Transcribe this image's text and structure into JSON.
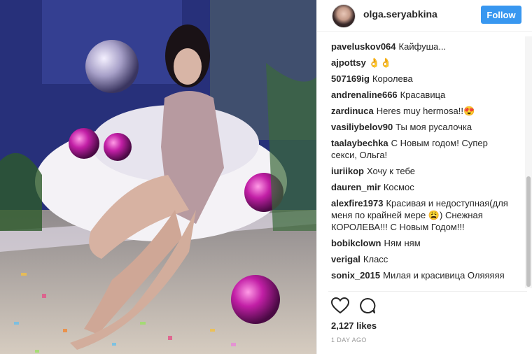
{
  "post": {
    "username": "olga.seryabkina",
    "follow_label": "Follow",
    "likes": "2,127 likes",
    "timestamp": "1 DAY AGO"
  },
  "comments": [
    {
      "user": "paveluskov064",
      "text": "Кайфуша..."
    },
    {
      "user": "ajpottsy",
      "text": "👌👌"
    },
    {
      "user": "507169ig",
      "text": "Королева"
    },
    {
      "user": "andrenaline666",
      "text": "Красавица"
    },
    {
      "user": "zardinuca",
      "text": "Heres muy hermosa!!😍"
    },
    {
      "user": "vasiliybelov90",
      "text": "Ты моя русалочка"
    },
    {
      "user": "taalaybechka",
      "text": "С Новым годом! Супер секси, Ольга!"
    },
    {
      "user": "iuriikop",
      "text": "Хочу к тебе"
    },
    {
      "user": "dauren_mir",
      "text": "Космос"
    },
    {
      "user": "alexfire1973",
      "text": "Красивая и недоступная(для меня по крайней мере 😩) Снежная КОРОЛЕВА!!! С Новым Годом!!!"
    },
    {
      "user": "bobikclown",
      "text": "Ням ням"
    },
    {
      "user": "verigal",
      "text": "Класс"
    },
    {
      "user": "sonix_2015",
      "text": "Милая и красивица Оляяяяя"
    }
  ],
  "icons": {
    "like": "heart-icon",
    "comment": "comment-bubble-icon"
  },
  "colors": {
    "follow_button": "#3897f0",
    "text": "#262626",
    "timestamp": "#999999"
  }
}
